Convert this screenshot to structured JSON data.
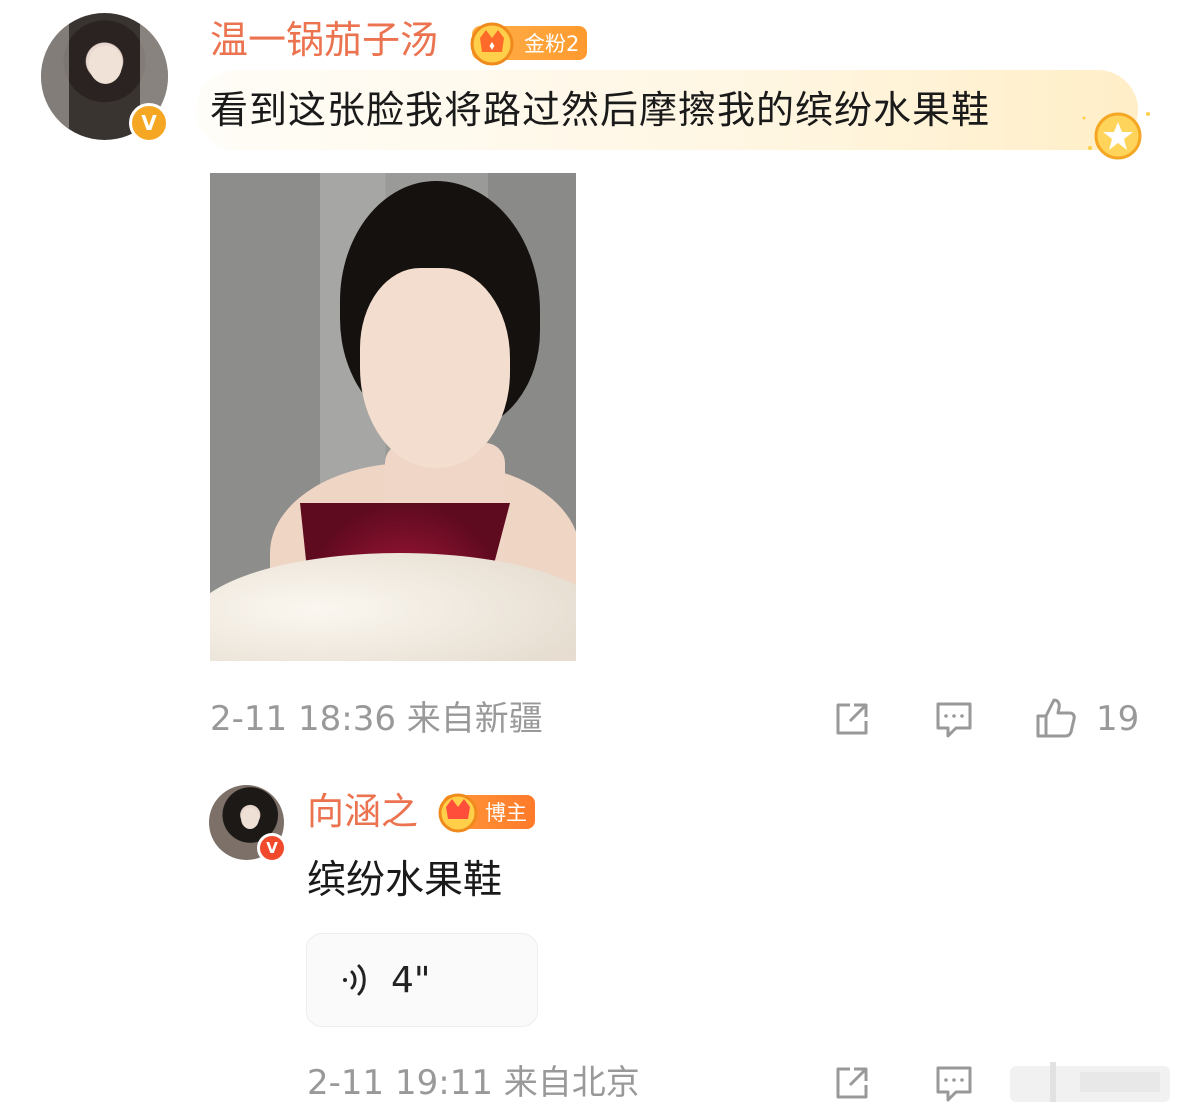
{
  "comment": {
    "user": {
      "name": "温一锅茄子汤",
      "badge_label": "金粉2",
      "verified_icon": "verified-v-icon"
    },
    "text": "看到这张脸我将路过然后摩擦我的缤纷水果鞋",
    "meta": "2-11 18:36  来自新疆",
    "like_count": "19"
  },
  "reply": {
    "user": {
      "name": "向涵之",
      "badge_label": "博主",
      "verified_icon": "verified-v-icon"
    },
    "text": "缤纷水果鞋",
    "voice_duration": "4\"",
    "meta": "2-11 19:11  来自北京"
  },
  "colors": {
    "name": "#eb7350",
    "meta": "#999999",
    "badge": "#ff9a2e"
  }
}
